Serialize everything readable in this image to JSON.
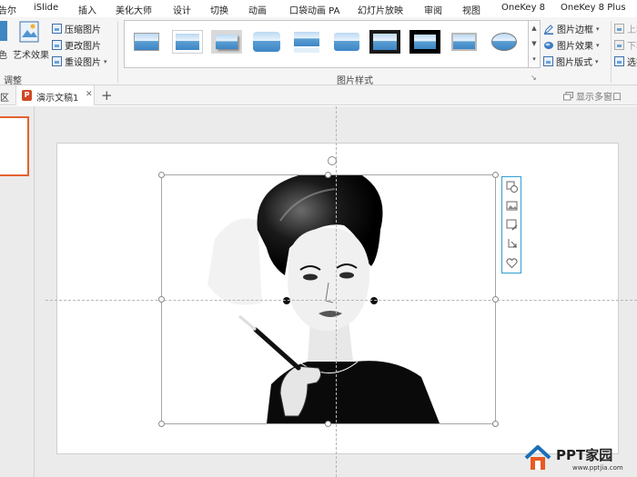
{
  "menu": {
    "tabs": [
      {
        "label": "告尔"
      },
      {
        "label": "iSlide"
      },
      {
        "label": "插入"
      },
      {
        "label": "美化大师"
      },
      {
        "label": "设计"
      },
      {
        "label": "切换"
      },
      {
        "label": "动画"
      },
      {
        "label": "口袋动画 PA"
      },
      {
        "label": "幻灯片放映"
      },
      {
        "label": "审阅"
      },
      {
        "label": "视图"
      },
      {
        "label": "OneKey 8"
      },
      {
        "label": "OneKey 8 Plus"
      }
    ]
  },
  "ribbon": {
    "adjust": {
      "color_label": "色",
      "artistic_label": "艺术效果",
      "compress_label": "压缩图片",
      "change_label": "更改图片",
      "reset_label": "重设图片",
      "group_label": "调整"
    },
    "styles": {
      "group_label": "图片样式",
      "border_label": "图片边框",
      "effects_label": "图片效果",
      "layout_label": "图片版式"
    },
    "arrange": {
      "up_label": "上移",
      "down_label": "下移",
      "select_label": "选择"
    }
  },
  "tabstrip": {
    "left_fragment": "区",
    "doc_tab_label": "演示文稿1",
    "close_glyph": "✕",
    "add_glyph": "+",
    "multi_window_label": "显示多窗口"
  },
  "watermark": {
    "brand": "PPT家园",
    "url": "www.pptjia.com"
  },
  "colors": {
    "accent_orange": "#e2622f",
    "float_toolbar_border": "#2f9fd1",
    "ppt_icon_red": "#d24726"
  }
}
